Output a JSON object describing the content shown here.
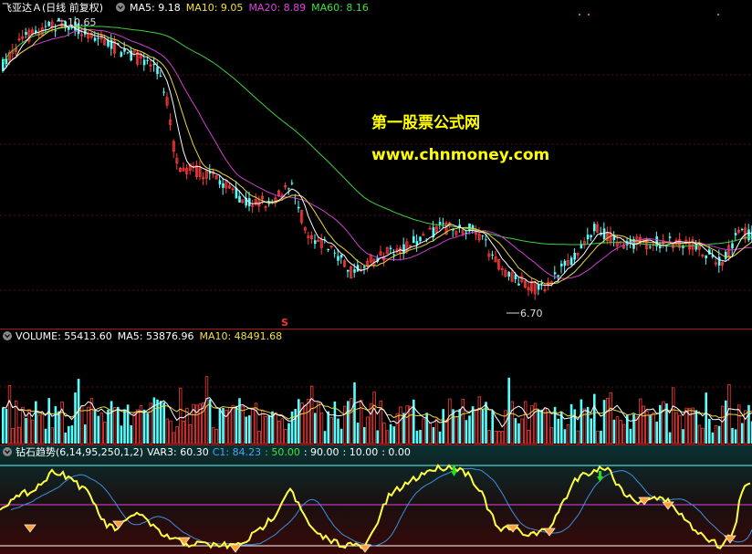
{
  "main_panel": {
    "stock_title": "飞亚达Ａ(日线 前复权)",
    "indicators": [
      {
        "label": "MA5: 9.18",
        "color": "#ffffff"
      },
      {
        "label": "MA10: 9.05",
        "color": "#f0e040"
      },
      {
        "label": "MA20: 8.89",
        "color": "#e040e0"
      },
      {
        "label": "MA60: 8.16",
        "color": "#40e040"
      }
    ],
    "high_label": "10.65",
    "low_label": "6.70",
    "signal_marker": "S",
    "watermark_line1": "第一股票公式网",
    "watermark_line2": "www.chnmoney.com"
  },
  "volume_panel": {
    "indicators": [
      {
        "label": "VOLUME: 55413.60",
        "color": "#ffffff"
      },
      {
        "label": "MA5: 53876.96",
        "color": "#ffffff"
      },
      {
        "label": "MA10: 48491.68",
        "color": "#f0e040"
      }
    ]
  },
  "oscillator_panel": {
    "indicators": [
      {
        "label": "钻石趋势(6,14,95,250,1,2)",
        "color": "#ffffff"
      },
      {
        "label": "VAR3: 60.30",
        "color": "#ffffff"
      },
      {
        "label": "C1: 84.23",
        "color": "#4aa0ff"
      },
      {
        "label": ": 50.00",
        "color": "#40e040"
      },
      {
        "label": ": 90.00",
        "color": "#ffffff"
      },
      {
        "label": ": 10.00",
        "color": "#ffffff"
      },
      {
        "label": ": 0.00",
        "color": "#ffffff"
      }
    ]
  },
  "colors": {
    "up": "#ff3a3a",
    "down": "#54ffff",
    "panel_separator": "#b01010"
  }
}
